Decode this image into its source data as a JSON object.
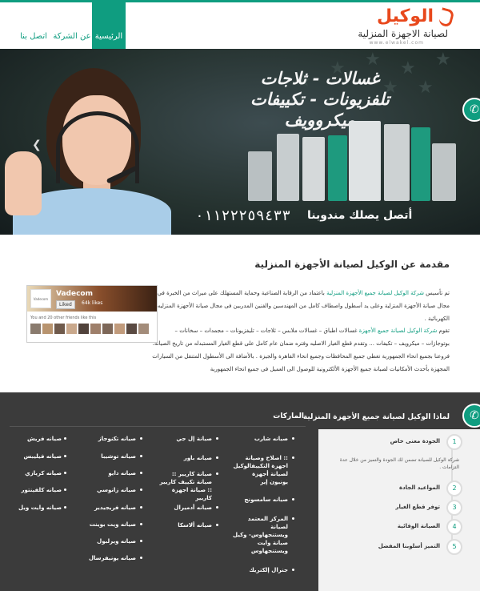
{
  "header": {
    "logo_main": "الوكيل",
    "logo_sub": "لصيانة الاجهزة المنزلية",
    "logo_url": "www.elwakel.com",
    "nav": [
      {
        "label": "الرئيسية",
        "active": true
      },
      {
        "label": "عن الشركة",
        "active": false
      },
      {
        "label": "اتصل بنا",
        "active": false
      }
    ]
  },
  "slider": {
    "line1": "غسالات - ثلاجات",
    "line2": "تلفزيونات - تكييفات",
    "line3": "ميكروويف",
    "cta": "أتصل يصلك مندوبنا",
    "phone": "٠١١٢٢٢٥٩٤٣٣",
    "prev_icon": "chevron-left-icon"
  },
  "intro": {
    "title": "مقدمة عن الوكيل لصيانة الأجهزة المنزلية",
    "p1_pre": "تم تأسيس ",
    "p1_link": "شركة الوكيل لصيانة جميع الأجهزة المنزلية",
    "p1_post": " باعتماد من الرقابة الصناعية وحماية المستهلك على ميراث من الخبرة في مجال صيانة الأجهزة المنزلية وعلى يد أسطول واصطاف كامل من المهندسين والفنين المدربين فى مجال صيانة الأجهزة المنزليه الكهربائية .",
    "p2_pre": "تقوم ",
    "p2_link": "شركة الوكيل  لصيانة جميع الأجهزة",
    "p2_post": " غسالات اطباق – غسالات ملابس – ثلاجات – تليفزيونات – مجمدات – سخانات – بوتوجازات – ميكرويف – تكيفات ... وتقدم قطع الغيار الاصليه وفتره ضمان عام كامل على قطع الغيار المستبدله من تاريخ الصيانه.",
    "p3": "فروعنا بجميع انحاء الجمهورية تغطي جميع المحافظات وجميع انحاء القاهرة والجيزة . بالأضافة الى الأسطول المتنقل من السيارات المجهزة بأحدث الأمكانيات لصيانة جميع الأجهزة الألكترونية للوصول الى العميل فى جميع انحاء الجمهورية"
  },
  "facebook": {
    "page_name": "Vadecom",
    "avatar_text": "Vadecom",
    "like_label": "Liked",
    "likes": "64k likes",
    "friends_text": "You and 20 other friends like this"
  },
  "features": {
    "title": "لماذا الوكيل لصيانة جميع الأجهزة المنزلية",
    "desc": "شركة الوكيل للصيانة تضمن لك الجودة والتميز من خلال عدة التزامات .",
    "items": [
      {
        "num": "1",
        "label": "الجودة معنى خاص"
      },
      {
        "num": "2",
        "label": "المواعيد الجادة"
      },
      {
        "num": "3",
        "label": "توفر قطع الغيار"
      },
      {
        "num": "4",
        "label": "الصيانة الوقائية"
      },
      {
        "num": "5",
        "label": "التميز أسلوبنا المفضل"
      }
    ]
  },
  "brands": {
    "title": "الماركات",
    "col1": [
      "صيانه شارب",
      ":: اصلاح وصيانة اجهزة التكييفالوكيل لصيانة أجهزة يونيون إير",
      "صيانه سامسونج",
      "المركز المعتمد لصيانة ويستنجهاوس- وكيل صيانة وايت ويستنجهاوس",
      "جنرال إلكتريك"
    ],
    "col2": [
      "صيانة إل جي",
      "صيانه باور",
      "صيانة كاريير :: صيانة تكييف كاريير :: صيانة اجهزة كاريير",
      "صيانه أدميرال",
      "صيانه ألاسكا"
    ],
    "col3": [
      "صيانه تكنوجاز",
      "صيانه توشيبا",
      "صيانه دايو",
      "صيانه زانوسي",
      "صيانه فريجيدير",
      "صيانه ويت بوينت",
      "صيانه ويرلبول",
      "صيانه يونيفرسال"
    ],
    "col4": [
      "صيانه فريش",
      "صيانه فيليبس",
      "صيانه كريازي",
      "صيانه كلفينتور",
      "صيانه وايت ويل"
    ]
  },
  "colors": {
    "accent": "#0f9d80",
    "logo": "#e8481c",
    "dark": "#3b3b3b"
  }
}
